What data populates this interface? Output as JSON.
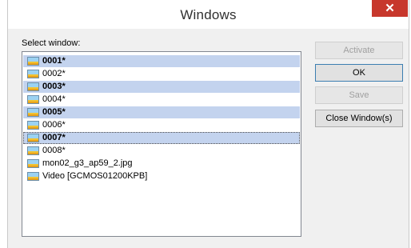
{
  "window": {
    "title": "Windows",
    "close_glyph": "✕"
  },
  "select_label": "Select window:",
  "items": [
    {
      "label": "0001*",
      "selected": true,
      "focused": false
    },
    {
      "label": "0002*",
      "selected": false,
      "focused": false
    },
    {
      "label": "0003*",
      "selected": true,
      "focused": false
    },
    {
      "label": "0004*",
      "selected": false,
      "focused": false
    },
    {
      "label": "0005*",
      "selected": true,
      "focused": false
    },
    {
      "label": "0006*",
      "selected": false,
      "focused": false
    },
    {
      "label": "0007*",
      "selected": true,
      "focused": true
    },
    {
      "label": "0008*",
      "selected": false,
      "focused": false
    },
    {
      "label": "mon02_g3_ap59_2.jpg",
      "selected": false,
      "focused": false
    },
    {
      "label": "Video [GCMOS01200KPB]",
      "selected": false,
      "focused": false
    }
  ],
  "buttons": {
    "activate": "Activate",
    "ok": "OK",
    "save": "Save",
    "close_windows": "Close Window(s)"
  },
  "colors": {
    "selection": "#c3d3ee",
    "close": "#c7372c"
  }
}
